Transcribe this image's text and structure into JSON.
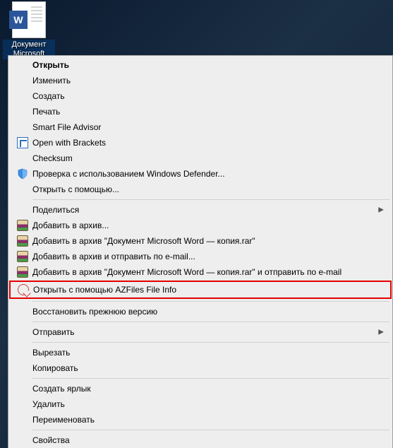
{
  "desktop": {
    "icon_badge_letter": "W",
    "icon_label": "Документ\nMicrosoft"
  },
  "menu": {
    "open": "Открыть",
    "edit": "Изменить",
    "create": "Создать",
    "print": "Печать",
    "smart_file_advisor": "Smart File Advisor",
    "open_with_brackets": "Open with Brackets",
    "checksum": "Checksum",
    "defender_scan": "Проверка с использованием Windows Defender...",
    "open_with": "Открыть с помощью...",
    "share": "Поделиться",
    "add_to_archive": "Добавить в архив...",
    "add_to_named_archive": "Добавить в архив \"Документ Microsoft Word — копия.rar\"",
    "add_and_email": "Добавить в архив и отправить по e-mail...",
    "add_to_named_and_email": "Добавить в архив \"Документ Microsoft Word — копия.rar\" и отправить по e-mail",
    "open_with_azfiles": "Открыть с помощью AZFiles File Info",
    "restore_previous": "Восстановить прежнюю версию",
    "send_to": "Отправить",
    "cut": "Вырезать",
    "copy": "Копировать",
    "create_shortcut": "Создать ярлык",
    "delete": "Удалить",
    "rename": "Переименовать",
    "properties": "Свойства"
  }
}
